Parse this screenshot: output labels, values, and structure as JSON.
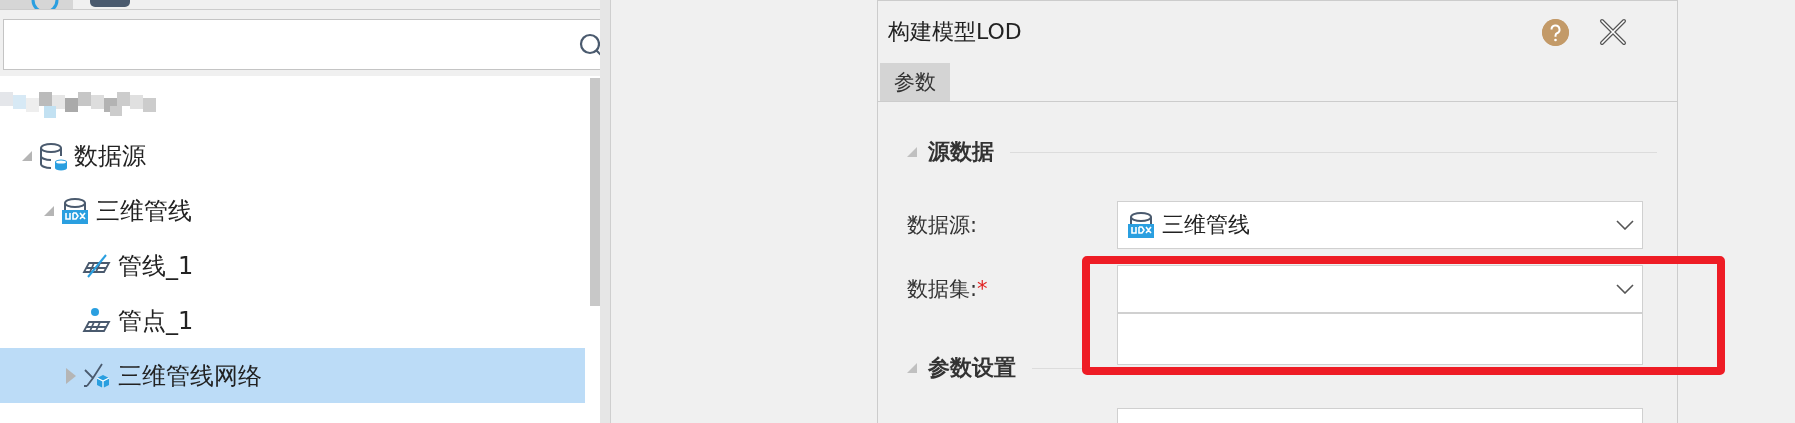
{
  "panel_tabs": [
    {
      "selected": true
    },
    {
      "selected": false
    }
  ],
  "tree": [
    {
      "label": "数据源",
      "kind": "datasource",
      "expanded": true,
      "selected": false,
      "children": [
        {
          "label": "三维管线",
          "kind": "udx",
          "expanded": true,
          "selected": false,
          "children": [
            {
              "label": "管线_1",
              "kind": "line",
              "selected": false
            },
            {
              "label": "管点_1",
              "kind": "point",
              "selected": false
            },
            {
              "label": "三维管线网络",
              "kind": "network",
              "expanded": false,
              "selected": true
            }
          ]
        }
      ]
    }
  ],
  "dialog": {
    "title": "构建模型LOD",
    "tabs": [
      {
        "label": "参数",
        "selected": true
      }
    ],
    "sections": [
      {
        "title": "源数据",
        "expanded": true,
        "fields": [
          {
            "kind": "dropdown",
            "label": "数据源:",
            "value": {
              "text": "三维管线",
              "kind": "udx"
            }
          },
          {
            "kind": "dropdown",
            "label": "数据集:",
            "required_mark": "*"
          },
          {
            "kind": "listbox"
          }
        ]
      },
      {
        "title": "参数设置",
        "expanded": true,
        "fields": [
          {
            "kind": "box"
          }
        ]
      }
    ]
  }
}
